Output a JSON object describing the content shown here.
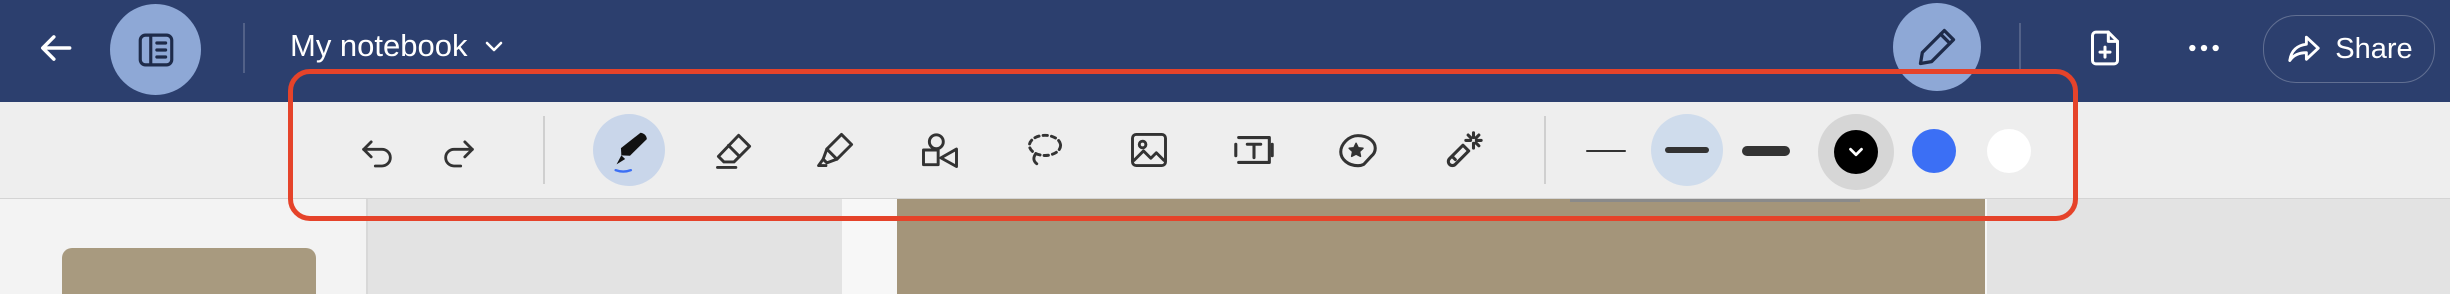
{
  "app": {
    "notebook_title": "My notebook",
    "share_label": "Share"
  },
  "icons": {
    "back": "arrow-left-icon",
    "sidebar_toggle": "sidebar-panel-icon",
    "title_chevron": "chevron-down-icon",
    "pen_mode": "pen-icon",
    "add_page": "file-plus-icon",
    "more": "more-horizontal-icon",
    "share": "share-arrow-icon"
  },
  "toolbar": {
    "tools": [
      "undo",
      "redo",
      "pen",
      "eraser",
      "highlighter",
      "shapes",
      "lasso",
      "image",
      "text-box",
      "sticker",
      "laser-pointer"
    ],
    "selected_tool": "pen",
    "stroke_widths": [
      "thin",
      "medium",
      "thick"
    ],
    "selected_width": "medium",
    "colors": [
      "#000000",
      "#3b6ff5",
      "#ffffff"
    ],
    "selected_color": "#000000"
  },
  "colors": {
    "appbar": "#2c3f6e",
    "accent_active": "#8ea8d6",
    "highlight_annotation": "#e5432a"
  }
}
